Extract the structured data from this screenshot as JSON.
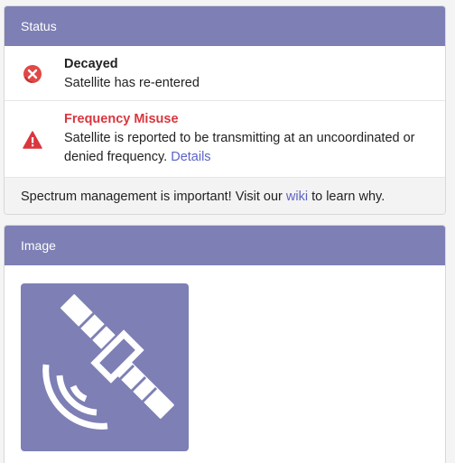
{
  "status_card": {
    "header": "Status",
    "items": [
      {
        "icon": "decayed-x-icon",
        "title": "Decayed",
        "desc": "Satellite has re-entered"
      },
      {
        "icon": "warning-icon",
        "title": "Frequency Misuse",
        "desc": "Satellite is reported to be transmitting at an uncoordinated or denied frequency.",
        "link": "Details"
      }
    ],
    "footer": {
      "text_before": "Spectrum management is important! Visit our",
      "link": "wiki",
      "text_after": "to learn why."
    }
  },
  "image_card": {
    "header": "Image",
    "image_icon": "satellite-icon"
  },
  "colors": {
    "header_bg": "#7d7fb5",
    "danger": "#d9363e",
    "link": "#5b63c7"
  }
}
